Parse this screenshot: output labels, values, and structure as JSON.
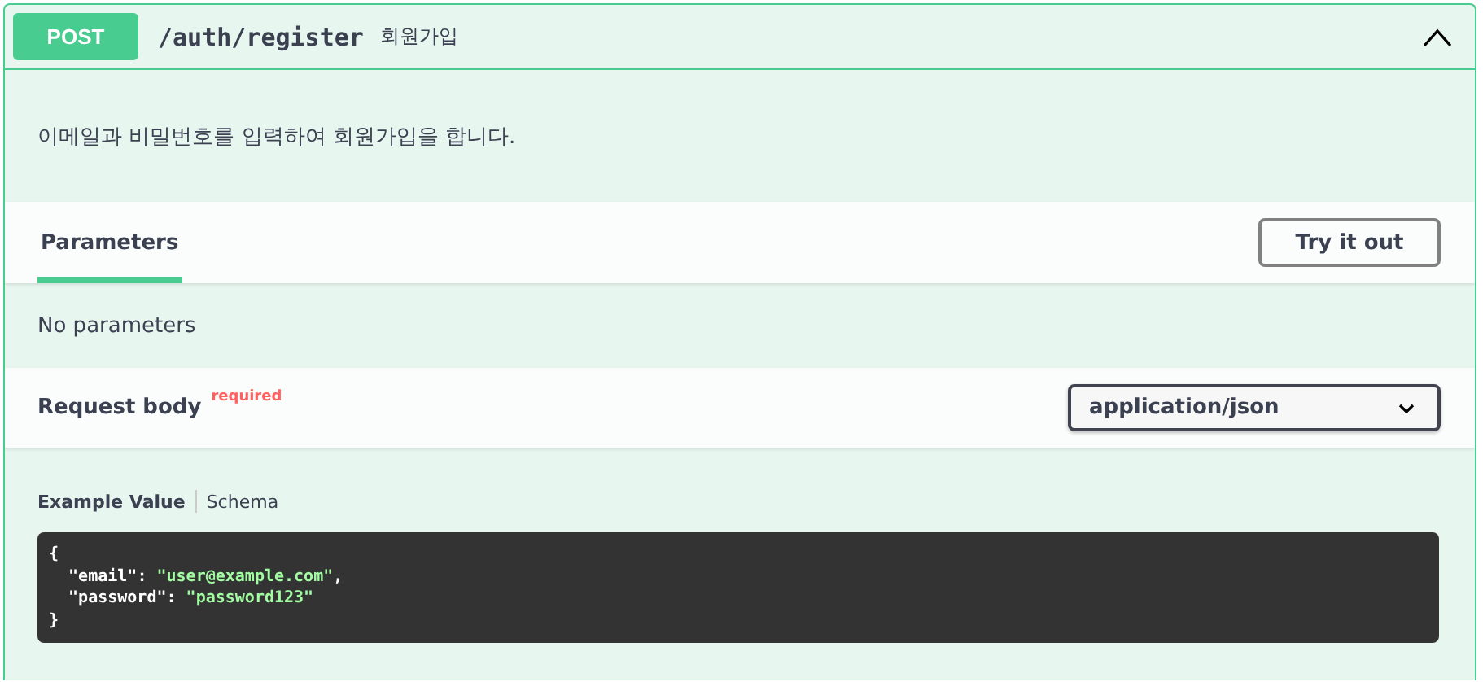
{
  "operation": {
    "method": "POST",
    "path": "/auth/register",
    "summary": "회원가입",
    "expanded": true
  },
  "description": "이메일과 비밀번호를 입력하여 회원가입을 합니다.",
  "parameters": {
    "tabs": [
      {
        "label": "Parameters",
        "selected": true
      }
    ],
    "try_button": "Try it out",
    "empty_text": "No parameters"
  },
  "request_body": {
    "title": "Request body",
    "required_label": "required",
    "content_type": "application/json"
  },
  "example_tabs": [
    {
      "label": "Example Value",
      "selected": true
    },
    {
      "label": "Schema",
      "selected": false
    }
  ],
  "example_code": [
    [
      {
        "kind": "punct",
        "text": "{"
      }
    ],
    [
      {
        "kind": "key",
        "text": "  \"email\""
      },
      {
        "kind": "punct",
        "text": ": "
      },
      {
        "kind": "string",
        "text": "\"user@example.com\""
      },
      {
        "kind": "punct",
        "text": ","
      }
    ],
    [
      {
        "kind": "key",
        "text": "  \"password\""
      },
      {
        "kind": "punct",
        "text": ": "
      },
      {
        "kind": "string",
        "text": "\"password123\""
      }
    ],
    [
      {
        "kind": "punct",
        "text": "}"
      }
    ]
  ]
}
